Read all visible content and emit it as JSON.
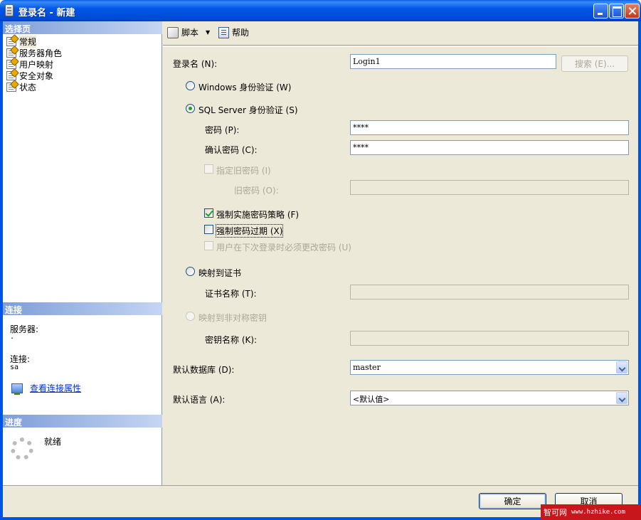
{
  "window": {
    "title": "登录名 - 新建"
  },
  "left": {
    "select_page_header": "选择页",
    "pages": [
      {
        "label": "常规",
        "icon": "page-icon"
      },
      {
        "label": "服务器角色",
        "icon": "page-icon"
      },
      {
        "label": "用户映射",
        "icon": "page-icon"
      },
      {
        "label": "安全对象",
        "icon": "page-icon"
      },
      {
        "label": "状态",
        "icon": "page-icon"
      }
    ],
    "connection_header": "连接",
    "server_label": "服务器:",
    "server_value": ".",
    "connection_label": "连接:",
    "connection_value": "sa",
    "view_connection_link": "查看连接属性",
    "progress_header": "进度",
    "progress_status": "就绪"
  },
  "toolbar": {
    "script_label": "脚本",
    "help_label": "帮助"
  },
  "form": {
    "login_name_label": "登录名 (N):",
    "login_name_value": "Login1",
    "search_button": "搜索 (E)...",
    "windows_auth_label": "Windows 身份验证 (W)",
    "sql_auth_label": "SQL Server 身份验证 (S)",
    "password_label": "密码 (P):",
    "password_value": "****",
    "confirm_password_label": "确认密码 (C):",
    "confirm_password_value": "****",
    "specify_old_password_label": "指定旧密码 (I)",
    "old_password_label": "旧密码 (O):",
    "enforce_policy_label": "强制实施密码策略 (F)",
    "enforce_expiration_label": "强制密码过期 (X)",
    "must_change_label": "用户在下次登录时必须更改密码 (U)",
    "map_cert_label": "映射到证书",
    "cert_name_label": "证书名称 (T):",
    "map_asym_key_label": "映射到非对称密钥",
    "key_name_label": "密钥名称 (K):",
    "default_db_label": "默认数据库 (D):",
    "default_db_value": "master",
    "default_lang_label": "默认语言 (A):",
    "default_lang_value": "<默认值>"
  },
  "footer": {
    "ok_button": "确定",
    "cancel_button": "取消"
  },
  "watermark": {
    "site_name": "智可网",
    "site_url": "www.hzhike.com"
  },
  "colors": {
    "titlebar": "#0054e3",
    "dialog_bg": "#ece9d8",
    "section_header": "#7e9ed8",
    "link": "#0033cc",
    "check_green": "#21a121"
  }
}
